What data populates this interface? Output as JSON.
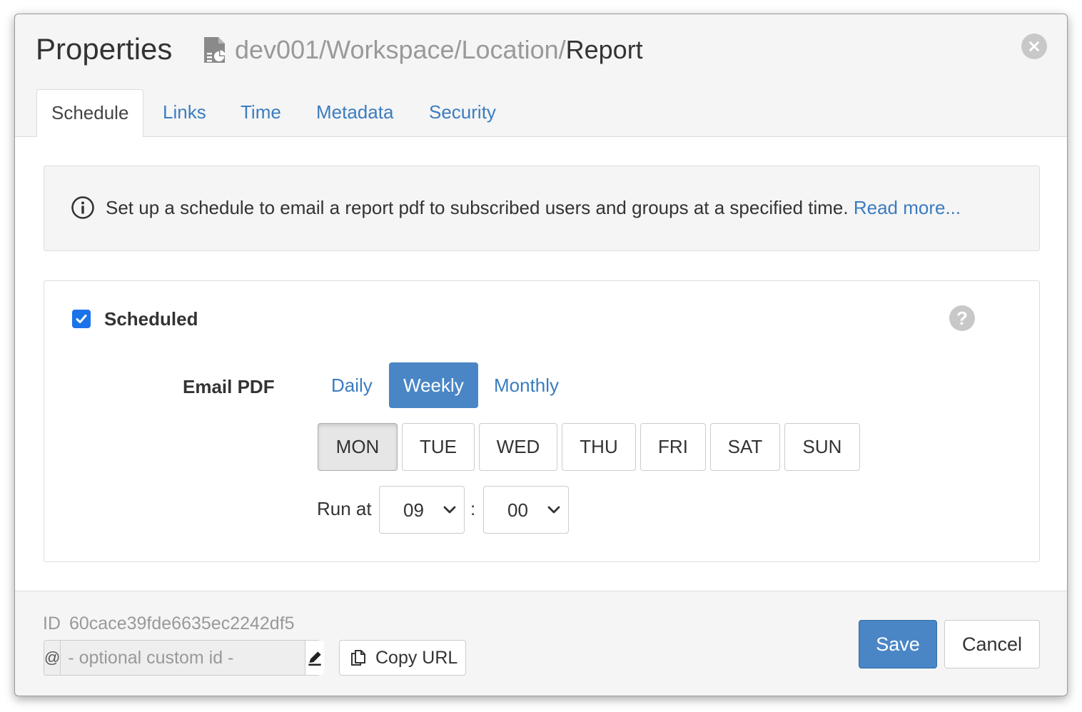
{
  "header": {
    "title": "Properties",
    "path_prefix": "dev001/Workspace/Location/",
    "path_leaf": "Report",
    "doc_icon": "report-document-icon",
    "close_icon": "close-icon"
  },
  "tabs": [
    {
      "label": "Schedule",
      "active": true
    },
    {
      "label": "Links",
      "active": false
    },
    {
      "label": "Time",
      "active": false
    },
    {
      "label": "Metadata",
      "active": false
    },
    {
      "label": "Security",
      "active": false
    }
  ],
  "info": {
    "text": "Set up a schedule to email a report pdf to subscribed users and groups at a specified time.",
    "link": "Read more..."
  },
  "schedule": {
    "checkbox_label": "Scheduled",
    "checked": true,
    "email_label": "Email PDF",
    "frequencies": [
      {
        "label": "Daily",
        "active": false
      },
      {
        "label": "Weekly",
        "active": true
      },
      {
        "label": "Monthly",
        "active": false
      }
    ],
    "days": [
      {
        "label": "MON",
        "active": true
      },
      {
        "label": "TUE",
        "active": false
      },
      {
        "label": "WED",
        "active": false
      },
      {
        "label": "THU",
        "active": false
      },
      {
        "label": "FRI",
        "active": false
      },
      {
        "label": "SAT",
        "active": false
      },
      {
        "label": "SUN",
        "active": false
      }
    ],
    "run_at_label": "Run at",
    "hour": "09",
    "separator": ":",
    "minute": "00"
  },
  "footer": {
    "id_label": "ID",
    "id_value": "60cace39fde6635ec2242df5",
    "at_symbol": "@",
    "custom_id_placeholder": "- optional custom id -",
    "copy_url_label": "Copy URL",
    "save_label": "Save",
    "cancel_label": "Cancel"
  },
  "colors": {
    "accent": "#4a86c6",
    "link": "#3b7cc0",
    "checkbox": "#1a73e8"
  }
}
